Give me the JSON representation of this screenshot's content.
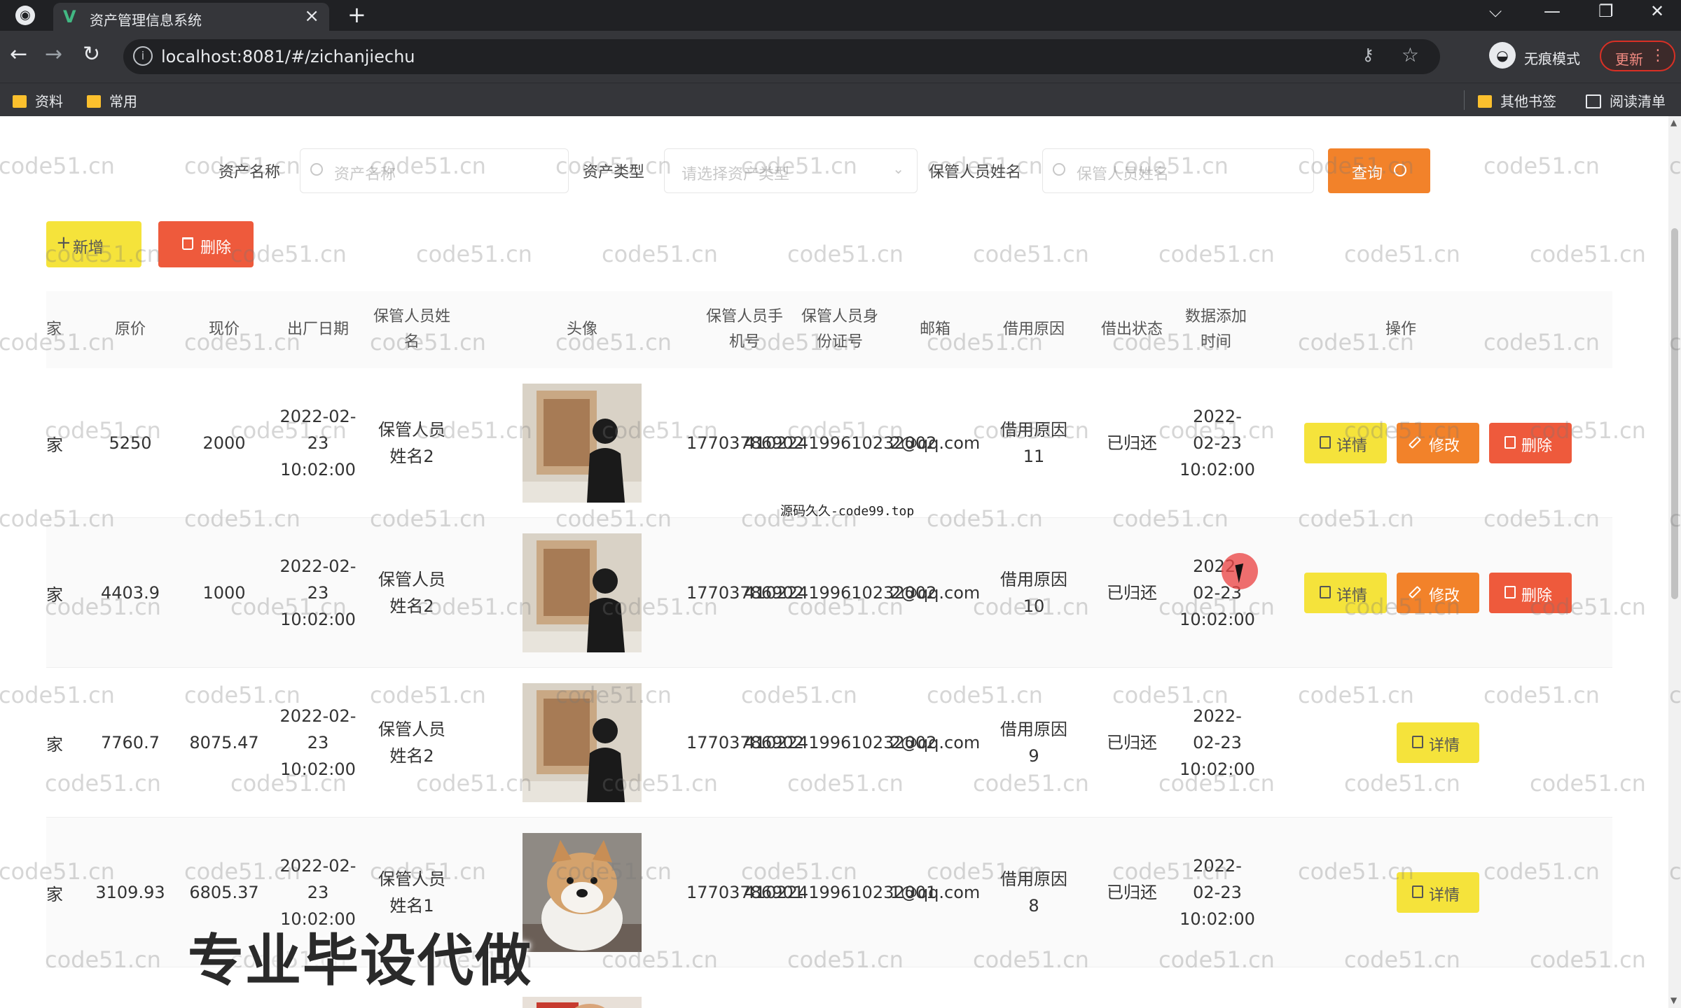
{
  "browser": {
    "tab_title": "资产管理信息系统",
    "url": "localhost:8081/#/zichanjiechu",
    "incognito_label": "无痕模式",
    "update_label": "更新",
    "bookmarks": [
      "资料",
      "常用"
    ],
    "bookmarks_right": [
      "其他书签",
      "阅读清单"
    ]
  },
  "search": {
    "asset_name_label": "资产名称",
    "asset_name_placeholder": "资产名称",
    "asset_type_label": "资产类型",
    "asset_type_placeholder": "请选择资产类型",
    "keeper_name_label": "保管人员姓名",
    "keeper_name_placeholder": "保管人员姓名",
    "query_label": "查询"
  },
  "toolbar": {
    "add_label": "新增",
    "delete_label": "删除"
  },
  "table": {
    "headers": {
      "factory": "家",
      "original_price": "原价",
      "current_price": "现价",
      "factory_date": "出厂日期",
      "keeper_name": "保管人员姓名",
      "avatar": "头像",
      "keeper_phone": "保管人员手机号",
      "keeper_id": "保管人员身份证号",
      "email": "邮箱",
      "borrow_reason": "借用原因",
      "borrow_status": "借出状态",
      "added_time": "数据添加时间",
      "actions": "操作"
    },
    "rows": [
      {
        "factory": "家",
        "original_price": "5250",
        "current_price": "2000",
        "factory_date": "2022-02-23 10:02:00",
        "keeper_name": "保管人员姓名2",
        "avatar": "person-photo",
        "keeper_phone": "17703786902",
        "keeper_id": "410224199610232002",
        "email": "2@qq.com",
        "borrow_reason": "借用原因11",
        "borrow_status": "已归还",
        "added_time": "2022-02-23 10:02:00",
        "actions": [
          "详情",
          "修改",
          "删除"
        ]
      },
      {
        "factory": "家",
        "original_price": "4403.9",
        "current_price": "1000",
        "factory_date": "2022-02-23 10:02:00",
        "keeper_name": "保管人员姓名2",
        "avatar": "person-photo",
        "keeper_phone": "17703786902",
        "keeper_id": "410224199610232002",
        "email": "2@qq.com",
        "borrow_reason": "借用原因10",
        "borrow_status": "已归还",
        "added_time": "2022-02-23 10:02:00",
        "actions": [
          "详情",
          "修改",
          "删除"
        ]
      },
      {
        "factory": "家",
        "original_price": "7760.7",
        "current_price": "8075.47",
        "factory_date": "2022-02-23 10:02:00",
        "keeper_name": "保管人员姓名2",
        "avatar": "person-photo",
        "keeper_phone": "17703786902",
        "keeper_id": "410224199610232002",
        "email": "2@qq.com",
        "borrow_reason": "借用原因9",
        "borrow_status": "已归还",
        "added_time": "2022-02-23 10:02:00",
        "actions": [
          "详情"
        ]
      },
      {
        "factory": "家",
        "original_price": "3109.93",
        "current_price": "6805.37",
        "factory_date": "2022-02-23 10:02:00",
        "keeper_name": "保管人员姓名1",
        "avatar": "dog-photo",
        "keeper_phone": "17703786901",
        "keeper_id": "410224199610232001",
        "email": "1@qq.com",
        "borrow_reason": "借用原因8",
        "borrow_status": "已归还",
        "added_time": "2022-02-23 10:02:00",
        "actions": [
          "详情"
        ]
      }
    ]
  },
  "overlays": {
    "watermark_text": "code51.cn",
    "video_subtitle": "源码久久-code99.top",
    "ad_text": "专业毕设代做"
  },
  "colors": {
    "detail_button": "#f5e33b",
    "edit_button": "#f2822a",
    "delete_button": "#ee5a3c",
    "query_button": "#f2822a"
  }
}
